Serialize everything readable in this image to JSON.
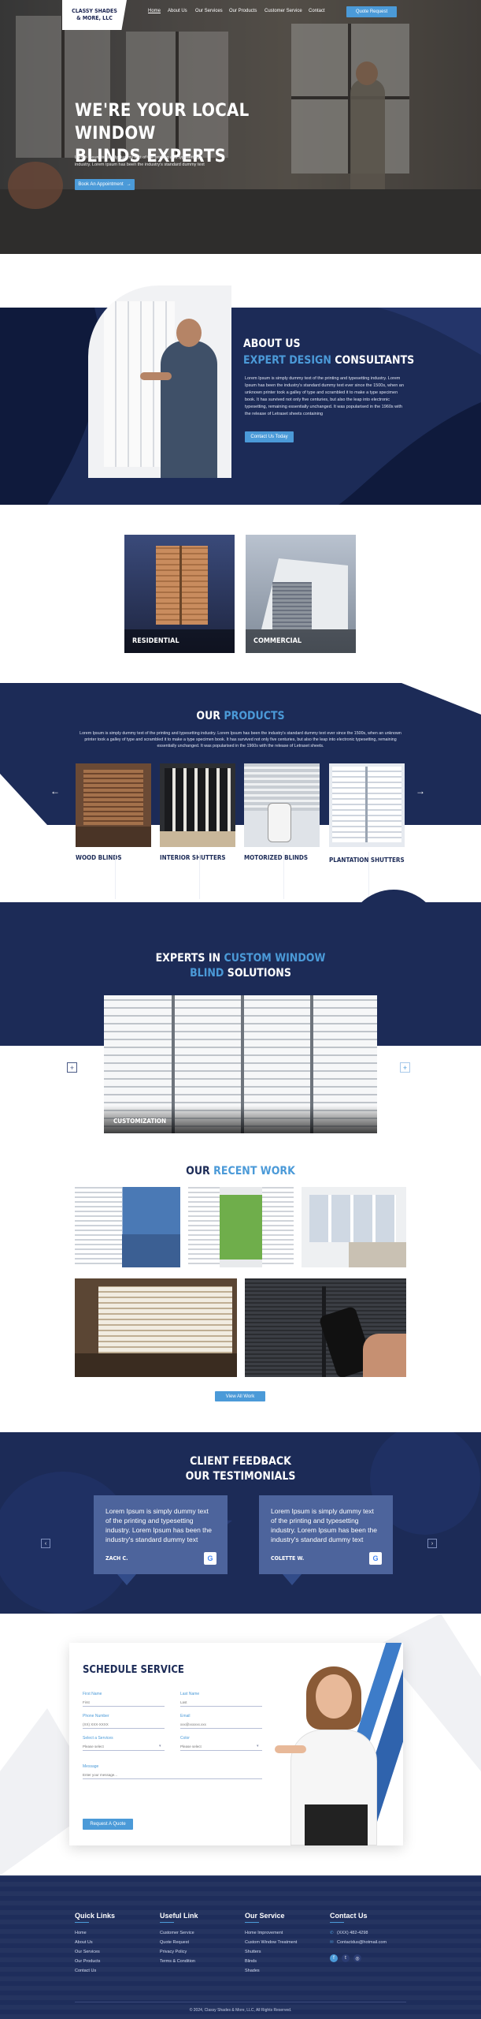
{
  "brand": {
    "name_line1": "CLASSY SHADES",
    "name_line2": "& MORE, LLC"
  },
  "nav": {
    "items": [
      "Home",
      "About Us",
      "Our Services",
      "Our Products",
      "Customer Service",
      "Contact"
    ],
    "cta": "Quote Request"
  },
  "hero": {
    "title_line1": "WE'RE YOUR LOCAL WINDOW",
    "title_line2": "BLINDS EXPERTS",
    "subtitle": "Lorem Ipsum is simply dummy text of the printing and typesetting industry. Lorem Ipsum has been the industry's standard dummy text",
    "button": "Book An Appointment",
    "button_icon": "arrow-right"
  },
  "about": {
    "title_line1": "ABOUT US",
    "title_hl": "EXPERT DESIGN",
    "title_rest": "CONSULTANTS",
    "text": "Lorem Ipsum is simply dummy text of the printing and typesetting industry. Lorem Ipsum has been the industry's standard dummy text ever since the 1500s, when an unknown printer took a galley of type and scrambled it to make a type specimen book. It has survived not only five centuries, but also the leap into electronic typesetting, remaining essentially unchanged. It was popularised in the 1960s with the release of Letraset sheets containing",
    "button": "Contact Us Today"
  },
  "categories": [
    "RESIDENTIAL",
    "COMMERCIAL"
  ],
  "products": {
    "title_plain": "OUR",
    "title_hl": "PRODUCTS",
    "text": "Lorem Ipsum is simply dummy text of the printing and typesetting industry. Lorem Ipsum has been the industry's standard dummy text ever since the 1500s, when an unknown printer took a galley of type and scrambled it to make a type specimen book. It has survived not only five centuries, but also the leap into electronic typesetting, remaining essentially unchanged. It was popularised in the 1960s with the release of Letraset sheets.",
    "items": [
      "WOOD BLINDS",
      "INTERIOR SHUTTERS",
      "MOTORIZED BLINDS",
      "PLANTATION SHUTTERS"
    ]
  },
  "experts": {
    "title_plain1": "EXPERTS IN",
    "title_hl1": "CUSTOM WINDOW",
    "title_hl2": "BLIND",
    "title_plain2": "SOLUTIONS",
    "slide_label": "CUSTOMIZATION"
  },
  "work": {
    "title_plain": "OUR",
    "title_hl": "RECENT WORK",
    "button": "View All Work"
  },
  "testimonials": {
    "title_line1": "CLIENT FEEDBACK",
    "title_line2": "OUR TESTIMONIALS",
    "items": [
      {
        "text": "Lorem Ipsum is simply dummy text of the printing and typesetting industry. Lorem Ipsum has been the industry's standard dummy text",
        "name": "ZACH C."
      },
      {
        "text": "Lorem Ipsum is simply dummy text of the printing and typesetting industry. Lorem Ipsum has been the industry's standard dummy text",
        "name": "COLETTE W."
      }
    ]
  },
  "schedule": {
    "title": "SCHEDULE SERVICE",
    "fields": {
      "first_name": {
        "label": "First Name",
        "placeholder": "First"
      },
      "last_name": {
        "label": "Last Name",
        "placeholder": "Last"
      },
      "phone": {
        "label": "Phone Number",
        "placeholder": "(XX) XXX-XXXX"
      },
      "email": {
        "label": "Email",
        "placeholder": "xxx@xxxxxx.xxx"
      },
      "service": {
        "label": "Select a Services",
        "placeholder": "Please select"
      },
      "color": {
        "label": "Color",
        "placeholder": "Please select"
      },
      "message": {
        "label": "Message",
        "placeholder": "Enter your message..."
      }
    },
    "button": "Request A Quote"
  },
  "footer": {
    "quick_links": {
      "title": "Quick Links",
      "items": [
        "Home",
        "About Us",
        "Our Services",
        "Our Products",
        "Contact Us"
      ]
    },
    "useful_link": {
      "title": "Useful Link",
      "items": [
        "Customer Service",
        "Quote Request",
        "Privacy Policy",
        "Terms & Condition"
      ]
    },
    "our_service": {
      "title": "Our Service",
      "items": [
        "Home Improvement",
        "Custom Window Treatment",
        "Shutters",
        "Blinds",
        "Shades"
      ]
    },
    "contact": {
      "title": "Contact Us",
      "phone": "(XXX) 482-4298",
      "email": "Contactdus@hotmail.com"
    },
    "copyright": "© 2024, Classy Shades & More, LLC, All Rights Reserved."
  },
  "colors": {
    "navy": "#1c2b57",
    "accent": "#4b9ad8"
  }
}
